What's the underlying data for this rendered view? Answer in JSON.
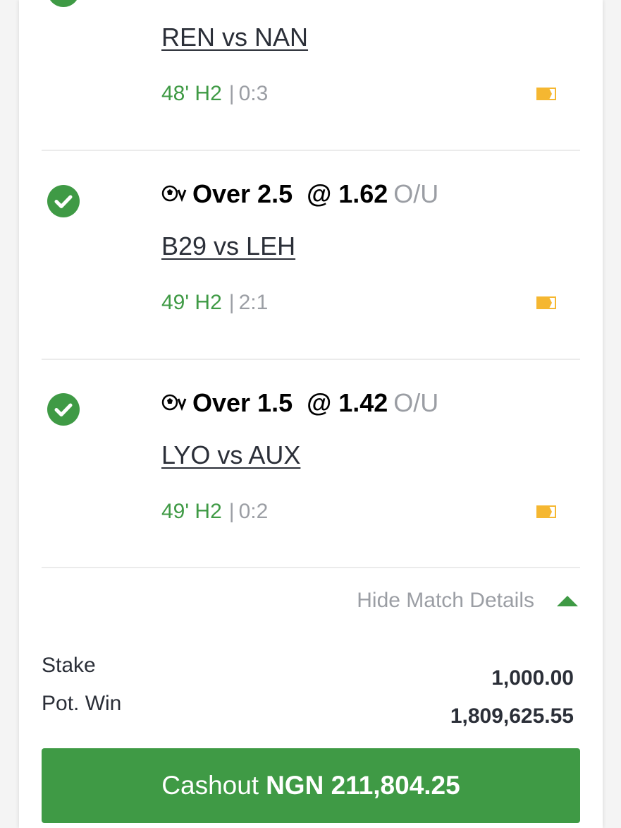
{
  "colors": {
    "accent_green": "#3f9a45",
    "muted_gray": "#9b9ea4",
    "text_dark": "#2b2f38",
    "flag_yellow": "#f5b731"
  },
  "matches": [
    {
      "selection": "",
      "odds": "",
      "market": "",
      "teams": "REN vs NAN",
      "time": "48' H2",
      "separator": "|",
      "score": "0:3",
      "status_icon": "check-icon",
      "sport_icon": "soccer-ball-icon"
    },
    {
      "selection": "Over 2.5",
      "odds": "@ 1.62",
      "market": "O/U",
      "teams": "B29 vs LEH",
      "time": "49' H2",
      "separator": "|",
      "score": "2:1",
      "status_icon": "check-icon",
      "sport_icon": "soccer-ball-icon"
    },
    {
      "selection": "Over 1.5",
      "odds": "@ 1.42",
      "market": "O/U",
      "teams": "LYO vs AUX",
      "time": "49' H2",
      "separator": "|",
      "score": "0:2",
      "status_icon": "check-icon",
      "sport_icon": "soccer-ball-icon"
    }
  ],
  "details_toggle": {
    "label": "Hide Match Details",
    "icon": "triangle-up-icon"
  },
  "summary": {
    "stake_label": "Stake",
    "stake_value": "1,000.00",
    "potwin_label": "Pot. Win",
    "potwin_value": "1,809,625.55"
  },
  "cashout": {
    "prefix": "Cashout",
    "amount": "NGN 211,804.25"
  }
}
